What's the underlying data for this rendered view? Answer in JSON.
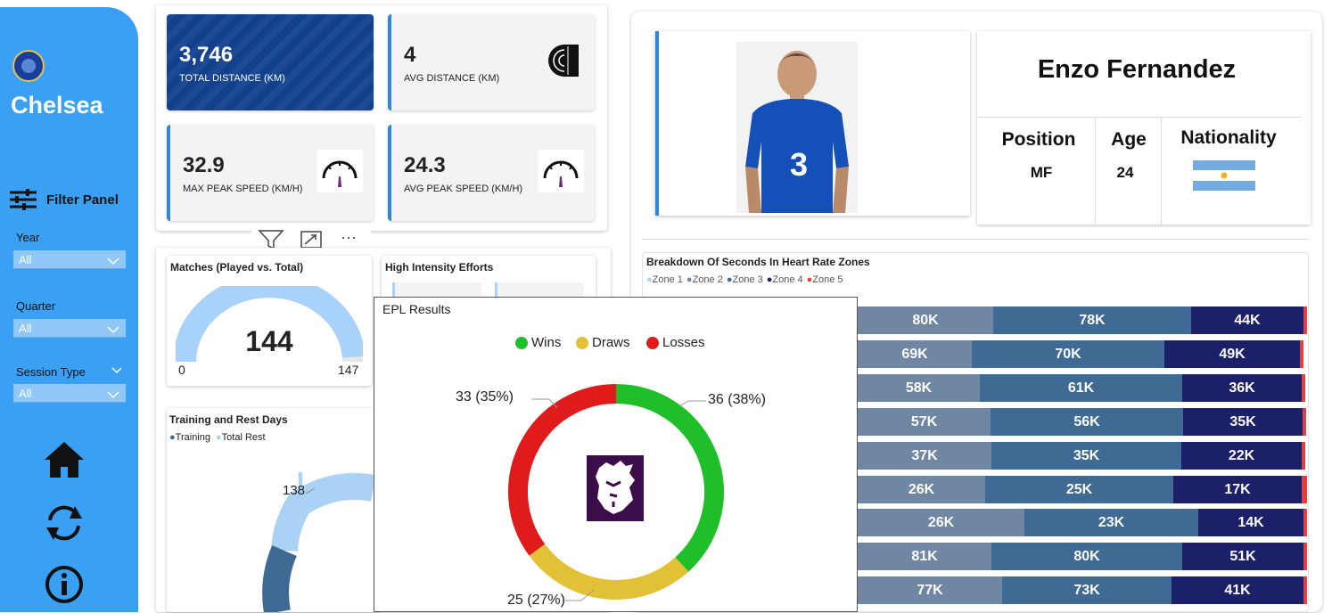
{
  "sidebar": {
    "club_name": "Chelsea",
    "filter_panel_label": "Filter Panel",
    "filters": [
      {
        "label": "Year",
        "value": "All"
      },
      {
        "label": "Quarter",
        "value": "All"
      },
      {
        "label": "Session Type",
        "value": "All"
      }
    ],
    "nav_icons": [
      "home-icon",
      "refresh-icon",
      "info-icon"
    ],
    "bg_color": "#3aa0f4"
  },
  "kpis": [
    {
      "value": "3,746",
      "caption": "TOTAL DISTANCE (KM)"
    },
    {
      "value": "4",
      "caption": "AVG DISTANCE (KM)"
    },
    {
      "value": "32.9",
      "caption": "MAX PEAK SPEED (KM/H)"
    },
    {
      "value": "24.3",
      "caption": "AVG PEAK SPEED (KM/H)"
    }
  ],
  "matches": {
    "title": "Matches (Played vs. Total)",
    "value": "144",
    "min": "0",
    "max": "147",
    "played": 144,
    "total": 147
  },
  "high_intensity": {
    "title": "High Intensity Efforts"
  },
  "training": {
    "title": "Training and Rest Days",
    "legend": [
      "Training",
      "Total Rest"
    ],
    "label_138": "138"
  },
  "profile": {
    "name": "Enzo Fernandez",
    "headers": [
      "Position",
      "Age",
      "Nationality"
    ],
    "position": "MF",
    "age": "24"
  },
  "heart_rate": {
    "title": "Breakdown Of Seconds In Heart Rate Zones",
    "legend": [
      "Zone 1",
      "Zone 2",
      "Zone 3",
      "Zone 4",
      "Zone 5"
    ],
    "colors": [
      "#a9d2f5",
      "#6f87a3",
      "#3f6a94",
      "#1c2068",
      "#e04040"
    ],
    "rows": [
      [
        "80K",
        "78K",
        "44K"
      ],
      [
        "69K",
        "70K",
        "49K"
      ],
      [
        "58K",
        "61K",
        "36K"
      ],
      [
        "57K",
        "56K",
        "35K"
      ],
      [
        "37K",
        "35K",
        "22K"
      ],
      [
        "26K",
        "25K",
        "17K"
      ],
      [
        "26K",
        "23K",
        "14K"
      ],
      [
        "81K",
        "80K",
        "51K"
      ],
      [
        "77K",
        "73K",
        "41K"
      ]
    ]
  },
  "epl": {
    "title": "EPL Results",
    "legend": [
      {
        "name": "Wins",
        "color": "#1fbf2a"
      },
      {
        "name": "Draws",
        "color": "#e2c136"
      },
      {
        "name": "Losses",
        "color": "#e01b1b"
      }
    ],
    "labels": {
      "wins": "36 (38%)",
      "draws": "25 (27%)",
      "losses": "33 (35%)"
    }
  },
  "chart_data": {
    "type": "pie",
    "title": "EPL Results",
    "categories": [
      "Wins",
      "Draws",
      "Losses"
    ],
    "values": [
      36,
      25,
      33
    ],
    "percent": [
      38,
      27,
      35
    ]
  }
}
